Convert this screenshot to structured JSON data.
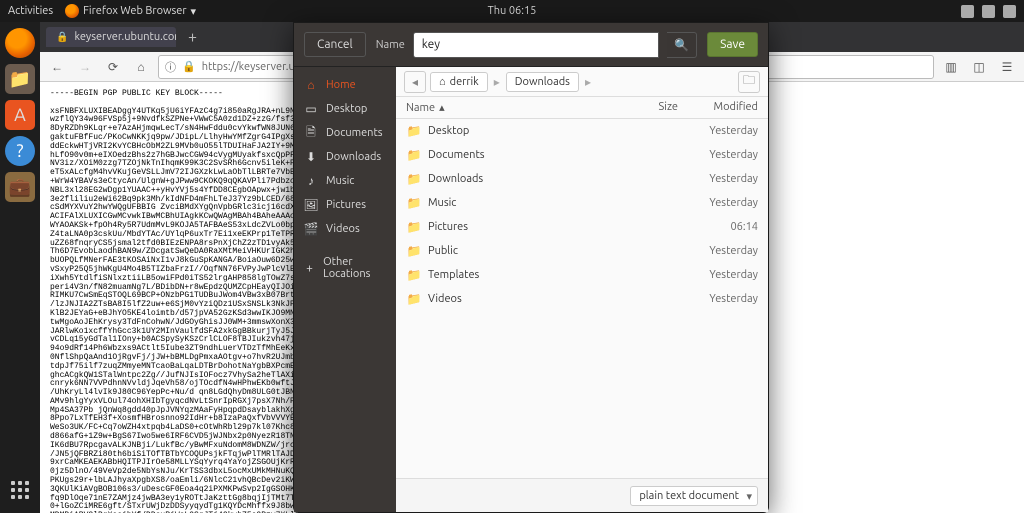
{
  "topbar": {
    "activities": "Activities",
    "app_label": "Firefox Web Browser",
    "clock": "Thu 06:15"
  },
  "firefox": {
    "tab_title": "keyserver.ubuntu.com/",
    "newtab": "+",
    "url": "https://keyserver.ubuntu.c"
  },
  "pgp_text": "-----BEGIN PGP PUBLIC KEY BLOCK-----\n\nxsFNBFXLUXIBEADggY4UTKq5jU6iYFAzC4g7i850aRgJRA+nL9NkrHamdtNggfVy\nwzflQY34w96FVSp5j+9NvdfkSZPNe+VWwC5A0zd1DZ+zzG/fsf3Ri9hz2eSityg0M\n8DyRZDh9KLqr+e7AzAHjmqwLecT/sN4HwFddu0cvYkwfWN8JUN6IIRrbT3ISo2\ngaktuFBfFuc/PKoCwNKKjq9pw/JDipL/LlhyHwYMfZgrG4IPgXs19/dKtDW7XX\nddEckwHTjVRI2KvYCBHcObM2ZL9MVb0uO55lTDUIHaFJA2IY+9MLp9A0eB2LodiXa\nhLfO90v0m+eIXOedzBhs2z7hGBJwcCGW94cVygMUyakfsxcQpPF4+VJihmDgp/kkP\nNV3iz/XOiM0zzg7TZOjNkTnIhqmK99K3C2SvSRh6Gcnv5ileK+PkNjjl2wE5xBu2m\neT5xALcfgM4hvVKujGeVSLLJmV72IJGXzkLwLaObTlLBRTe7VbBbgzBdb1KiLm\n+WrW4YBAVs3eCtycAn/UlgnW+gJPww9CKOKQ9qQKAVPli7PdbzojMPi1rfOF5PitV8\nNBL3xl28EG2wDgp1YUAAC++yHvYVj5s4YfDD8CEgbOApwx+jw1bt5Ku0g8rByrzC6\n3e2fliliu2eWi62Bq9pk3Mh/kIdNFD4mFhLTeJ37Yz9bLCED/68nyf8oywARAQAB\ncSdMYXVuY2hwYWQgUFBBIG ZvciBMdXYgQnVpbGRlc3icj16cdXZJZIFRYU3WCKwEEwEC\nACIFAlXLUXICGwMCvwkIBwMCBhUIAgkKCwQWAgMBAh4BAheAAAoJEPyuEQsRGCE8\nWYAOAKSk+fpOh4Ry5R7UdmMvL9KOJA5TAFBAeS53xLdcZVLo0bpnvad1RqJ8gTZyY\nZ4taLNA0p3cskUu/MbdYTAc/UYlqP6uxTr7Ei1xeEKPrp1TeTPRV28Ugc1vHyd1I\nuZZ68fnqryCS5jsmal2tfd0BIEzENPA8rsPnXjChZ2zTD1vyAk5TuwhgQt54fNrS\nTh6D7EvobLaodhBAN9w/ZDcgatSwQeDA0RaXMtMeiVHKUrIGK2hJoL59NDFVueIsd\nbUOPQLfMNerFAE3tKOSAiNxI1vJ8kGuSpKANGA/BoiaOuw6D25wKj+47oeKDEVXj\nvSxyP25Q5jhWKgU4Mo4B5TIZbaFrzI//OqfNN76FVPyJwPlcVlBZUlA7Ue5UuUMeyb\niXwh5YtdlfiSNlxztiiLB5owiFPd0iTS52lrgAHP858lgTOwZ7sEJTZwTt04zhM\nperi4V3n/fN82muamNg7L/BDibDN+r8wEpdzQUMZCpHEayQIJOiTJ9fbOVJAq\nRIMKU7CwSmEqSTOQL69BCP+ONzbPG1TUDBuJWom4VBw3xB07Brtmz5/fbKuhtu/2N\n/lzJNJIA2ZTsBA8I5lfZ2uw+e6SjM0vYziQDz1USxSNSLk3NkJPNbDUNKvz221aP\nKlB2JEYaG+eBJhYO5KE4loimtb/d57jpVA52GzKSd3wwIKJO9MNa8cB8ABCAAGBDJa\ntwMgoAoJEhKrysy3TdFnCohwN/JdGOyGhisJJ0WM+3mmswXonX37kbyMurgBhuIEr\nJARlwKo1xcffYhGcc3k1UY2MInVaulfdSFA2xkGgBBkurjTyJ5Jo7SndJSbOhMo\nvCDLq15yGdTal1IOny+b0ACSpySyKSzCrlCLOF8TBJIukzvh47jd/mXOD8XlZ2Oogu\n94o9dRf14Ph6Wbzxs9ACtlt5Iube3ZT9ndhLuerVTDzTfMhEeKxB/czIpzJOrt6Iz\n0NflShpQaAnd1OjRgvFj/jJW+bBMLDgPmxaAOtgv+o7hvR2UJmb1JOU8lumeCS3T\ntdpJf75ilf7zuqZMmyeMNTcaoBaLqaLDTBrDohotNaYgbBXPcmEwEEAEIAAYFAlq4\nghcACgkQW1STalWntpc2Zg//JufNJIsIOFocz7VhySa2heTlAXiES+wMv4u1yKzr\ncnryk6NN7VVPdhnNVvldjJqeVh58/ojTOcdfN4wHPhwEKb0wftJxpy2ysBN/aJbonN\n/UhKryLl4lvIk9J80C96YepPc+Nu/d qn8LGdQhyDm8ULG0tJBNn76EwN67B2zPz2NL/1PCGS\nAMv9hlgYyxVLOul74ohXHIbTgyqcdNvLtSnrIpRGXj7psX7Nh/PQKGJpUH7NCTy1\nMp4SA37Pb jQnWq8gdd40pJpJVNYqzMAaFyHpqpdDsayblakhXgo/AJrXd8/9AP72wf\n8Ppo7LxTfEH3f+XosmfHBrosnno92IdHr+b8IzaPaQxfVbVVVYB/tZHc34bvDC7vnwj\nWeSo3UK/FC+Cq7oWZH4xtpqb4LaDS0+cOtWhRbl29p7kl07Khc8EFE6OG0GSeLDDheFkj\nd866afG+1Z9w+BgS67Iwo5we6IRF6CVD5jWJNbx2p0NyezR18TNT6fNLPhu6d2Eh16\nIK6dBU7RpcgavALKJNBji/LukfBc/yBwMFxuNdomM8WDNZW/jrcNdp9cYsi5HsKoNTBdRBhU\n/JN5jQFBRZi80th6biSiTOfTBTbYCOQUPsjkFTqjwPlTMRlTAJDZZmXyTJ3Ds3Cw8g\n9xrCaMKEAEKABbHQITPJIrOe58MLLYSqYyrq4YaYojZSGOUjKrRtAAAKCRApThaY\n0jz5DlnO/49VeVp2de5NbYsNJu/KrTSS3dbxL5ocMxUMkMHNuKQZbfeL18FBsuoDCep\nPKUgs29r+lbLAJhyaXpgbXS8/oaEmli/6NlcC21vhQBcDev2iKWr/yGm4bJ8ggkVXcfB\n3QKUlKiAVgBOB106s3/uDescGF0Eoa4q2iPXMKPwSvp2IgGSOHK4T02xxg00plsR\nfq9DlOqe71nE7ZAMjz4jwBA3ey1yROTtJaKzttGg8bqjIjTMt7TOi1GrDkr6192\n0+lGoZCiMRE6gft/STxrUWjDzDDSyyqydTg1KQYDcMhffx9J8bwyNeX3vrnFBdbqD\nMDMBiARV3lBqXcsjbYf/DDsxRjWsL9SgJTj4OkwbZ5o9Pzy7XLl0Dooml4pUMwyyU\npXZkE0edaEBTYs/LnEWZOIxKA+2v6d4w+YBDJKWhPDEGMQXrozeE7XJwhM5Lpn91vZ\nyJlooLSViUNlWPKS3BqFVQoXxaMo6mejHesVKzRZQ5jqCyrZZEM+NRtYo6EfvZ\n0Ezcqyg9KXGFPwkUNznor290JNI4IpdkKCqLME4G+taZ7afoYfg7YE0A4gyYZdaKd t37\nzFo1YBSR40UXLNNZrCwuxaJjbuGjjKVZZeahnRf8fh/yYa2pkmrFodypvXOtOgX8Ox5x+cDX\n+xMlaMef0ts3o+Mii1tuMaBpi4jjL3cqdc/ugwEW5R4i9No1I4xLqpDmzQEqQoOAAQnA",
  "dialog": {
    "cancel": "Cancel",
    "name_label": "Name",
    "name_value": "key",
    "save": "Save",
    "path": {
      "user": "derrik",
      "folder": "Downloads"
    },
    "sidebar": {
      "home": "Home",
      "desktop": "Desktop",
      "documents": "Documents",
      "downloads": "Downloads",
      "music": "Music",
      "pictures": "Pictures",
      "videos": "Videos",
      "other": "Other Locations"
    },
    "headers": {
      "name": "Name",
      "size": "Size",
      "modified": "Modified"
    },
    "files": [
      {
        "name": "Desktop",
        "size": "",
        "modified": "Yesterday"
      },
      {
        "name": "Documents",
        "size": "",
        "modified": "Yesterday"
      },
      {
        "name": "Downloads",
        "size": "",
        "modified": "Yesterday"
      },
      {
        "name": "Music",
        "size": "",
        "modified": "Yesterday"
      },
      {
        "name": "Pictures",
        "size": "",
        "modified": "06:14"
      },
      {
        "name": "Public",
        "size": "",
        "modified": "Yesterday"
      },
      {
        "name": "Templates",
        "size": "",
        "modified": "Yesterday"
      },
      {
        "name": "Videos",
        "size": "",
        "modified": "Yesterday"
      }
    ],
    "filetype": "plain text document"
  }
}
